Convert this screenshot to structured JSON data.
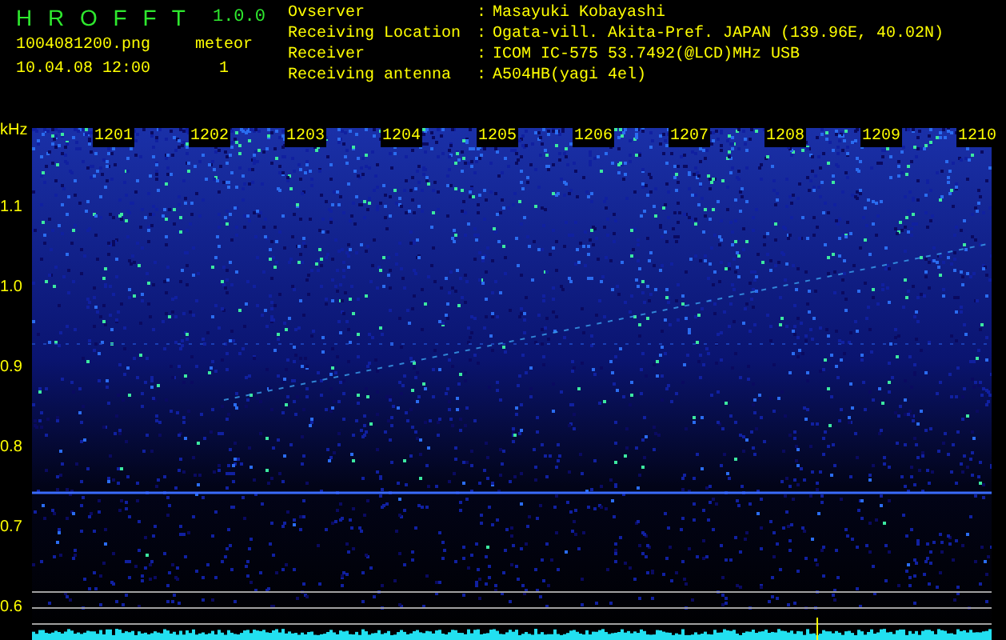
{
  "header": {
    "app_name": "H R O F F T",
    "version": "1.0.0",
    "file": "1004081200.png",
    "datetime": "10.04.08 12:00",
    "counter_label": "meteor",
    "counter_value": "1"
  },
  "info": [
    {
      "label": "Ovserver",
      "sep": ":",
      "value": "Masayuki Kobayashi"
    },
    {
      "label": "Receiving Location",
      "sep": ":",
      "value": "Ogata-vill. Akita-Pref. JAPAN (139.96E, 40.02N)"
    },
    {
      "label": "Receiver",
      "sep": ":",
      "value": "ICOM IC-575 53.7492(@LCD)MHz USB"
    },
    {
      "label": "Receiving antenna",
      "sep": ":",
      "value": "A504HB(yagi 4el)"
    }
  ],
  "y_axis": {
    "unit": "kHz",
    "labels": [
      "1.1",
      "1.0",
      "0.9",
      "0.8",
      "0.7",
      "0.6"
    ]
  },
  "time_labels": [
    "1201",
    "1202",
    "1203",
    "1204",
    "1205",
    "1206",
    "1207",
    "1208",
    "1209",
    "1210"
  ]
}
